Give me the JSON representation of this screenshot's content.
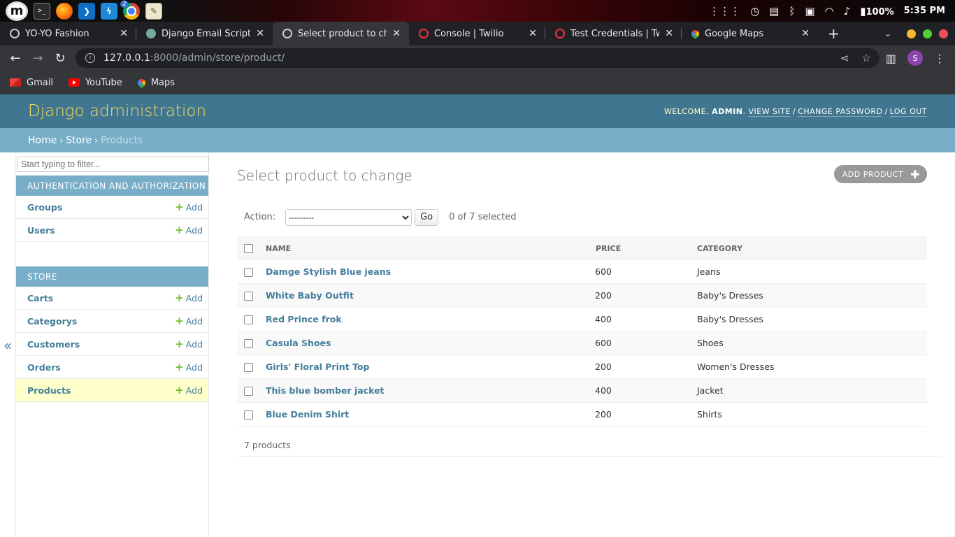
{
  "os_panel": {
    "logo_letter": "m",
    "app_badge": "2",
    "terminal_glyph": ">_",
    "battery": "100%",
    "time": "5:35 PM"
  },
  "browser": {
    "tabs": [
      {
        "title": "YO-YO Fashion",
        "favicon": "globe-icon"
      },
      {
        "title": "Django Email Script",
        "favicon": "chatgpt-icon"
      },
      {
        "title": "Select product to change",
        "favicon": "globe-icon"
      },
      {
        "title": "Console | Twilio",
        "favicon": "twilio-icon"
      },
      {
        "title": "Test Credentials | Twilio",
        "favicon": "twilio-icon"
      },
      {
        "title": "Google Maps",
        "favicon": "maps-icon"
      }
    ],
    "url_host": "127.0.0.1",
    "url_path": ":8000/admin/store/product/",
    "profile_initial": "S",
    "bookmarks": [
      {
        "label": "Gmail"
      },
      {
        "label": "YouTube"
      },
      {
        "label": "Maps"
      }
    ]
  },
  "admin": {
    "branding": "Django administration",
    "welcome": "Welcome,",
    "user": "admin",
    "view_site": "View site",
    "change_password": "Change password",
    "log_out": "Log out",
    "breadcrumbs": {
      "home": "Home",
      "store": "Store",
      "current": "Products"
    },
    "filter_placeholder": "Start typing to filter...",
    "nav": {
      "auth_caption": "Authentication and Authorization",
      "auth_items": [
        "Groups",
        "Users"
      ],
      "store_caption": "Store",
      "store_items": [
        "Carts",
        "Categorys",
        "Customers",
        "Orders",
        "Products"
      ],
      "add_label": "Add"
    },
    "page_title": "Select product to change",
    "add_button": "Add product",
    "action_label": "Action:",
    "action_selected": "---------",
    "go_label": "Go",
    "selected_count": "0 of 7 selected",
    "columns": {
      "name": "Name",
      "price": "Price",
      "category": "Category"
    },
    "rows": [
      {
        "name": "Damge Stylish Blue jeans",
        "price": "600",
        "category": "Jeans"
      },
      {
        "name": "White Baby Outfit",
        "price": "200",
        "category": "Baby's Dresses"
      },
      {
        "name": "Red Prince frok",
        "price": "400",
        "category": "Baby's Dresses"
      },
      {
        "name": "Casula Shoes",
        "price": "600",
        "category": "Shoes"
      },
      {
        "name": "Girls' Floral Print Top",
        "price": "200",
        "category": "Women's Dresses"
      },
      {
        "name": "This blue bomber jacket",
        "price": "400",
        "category": "Jacket"
      },
      {
        "name": "Blue Denim Shirt",
        "price": "200",
        "category": "Shirts"
      }
    ],
    "paginator": "7 products",
    "collapse_glyph": "«"
  },
  "colors": {
    "header_bg": "#417690",
    "branding": "#f5dd5d",
    "breadcrumb_bg": "#79aec8",
    "link": "#447e9b",
    "add_plus": "#70bf2b",
    "current_row": "#ffffcc"
  }
}
